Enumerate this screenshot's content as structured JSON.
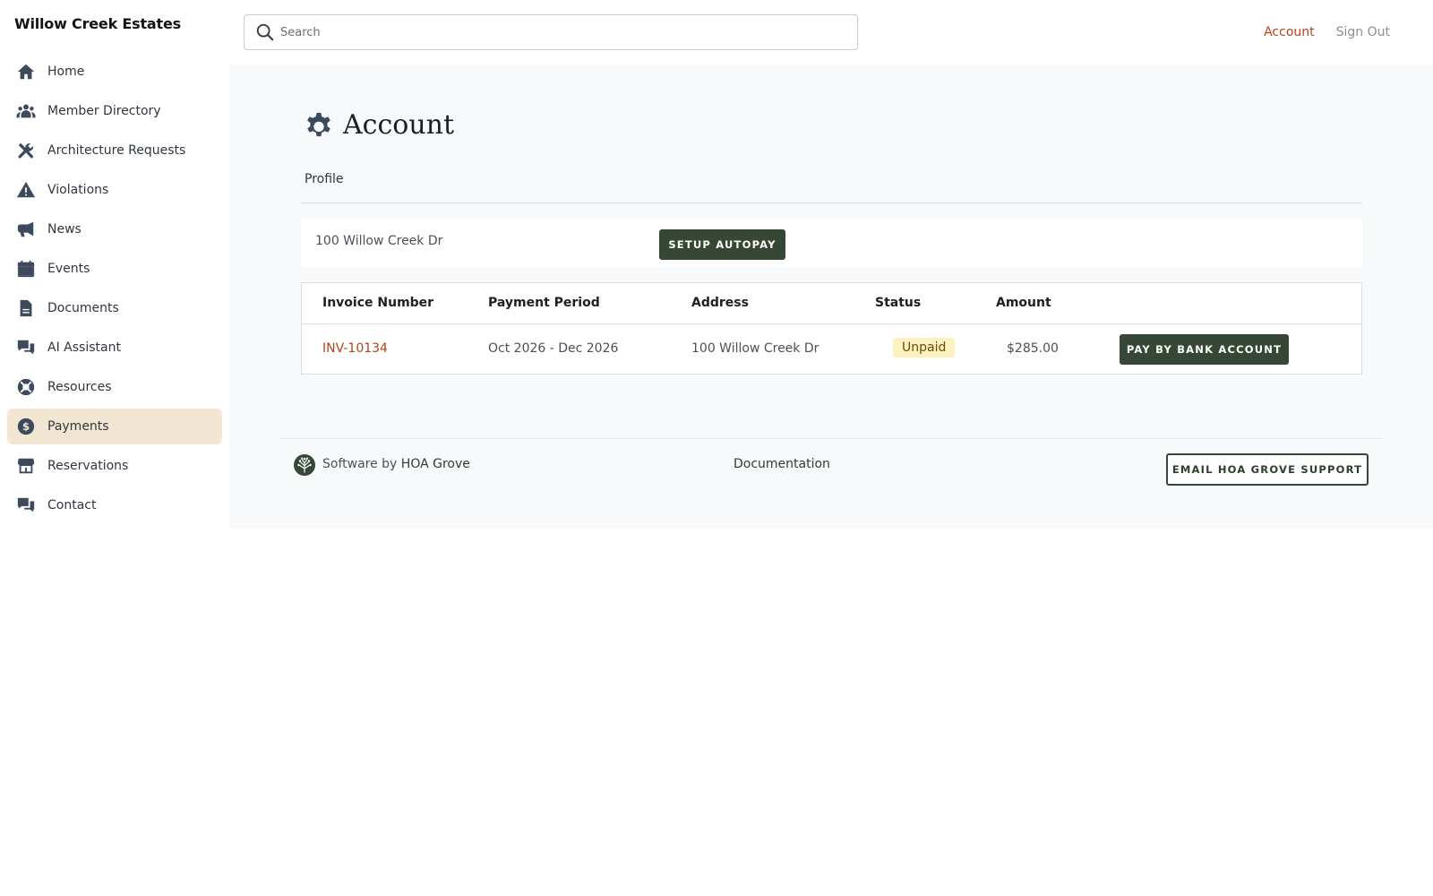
{
  "brand": "Willow Creek Estates",
  "search": {
    "placeholder": "Search"
  },
  "top_links": {
    "account": "Account",
    "sign_out": "Sign Out"
  },
  "sidebar": {
    "items": [
      {
        "label": "Home",
        "icon": "home-icon"
      },
      {
        "label": "Member Directory",
        "icon": "users-icon"
      },
      {
        "label": "Architecture Requests",
        "icon": "tools-icon"
      },
      {
        "label": "Violations",
        "icon": "warning-icon"
      },
      {
        "label": "News",
        "icon": "megaphone-icon"
      },
      {
        "label": "Events",
        "icon": "calendar-icon"
      },
      {
        "label": "Documents",
        "icon": "document-icon"
      },
      {
        "label": "AI Assistant",
        "icon": "chat-icon"
      },
      {
        "label": "Resources",
        "icon": "lifebuoy-icon"
      },
      {
        "label": "Payments",
        "icon": "dollar-icon",
        "active": true
      },
      {
        "label": "Reservations",
        "icon": "building-icon"
      },
      {
        "label": "Contact",
        "icon": "chat-icon"
      }
    ]
  },
  "page": {
    "title": "Account",
    "subtab": "Profile",
    "address": "100 Willow Creek Dr",
    "setup_autopay": "SETUP AUTOPAY"
  },
  "invoices": {
    "headers": [
      "Invoice Number",
      "Payment Period",
      "Address",
      "Status",
      "Amount"
    ],
    "rows": [
      {
        "invoice": "INV-10134",
        "period": "Oct 2026 - Dec 2026",
        "address": "100 Willow Creek Dr",
        "status": "Unpaid",
        "amount": "$285.00",
        "action": "PAY BY BANK ACCOUNT"
      }
    ]
  },
  "footer": {
    "software_by": "Software by",
    "vendor": "HOA Grove",
    "documentation": "Documentation",
    "support_button": "EMAIL HOA GROVE SUPPORT"
  },
  "colors": {
    "accent_dark_green": "#364735",
    "link_orange": "#b5431b",
    "active_nav_bg": "#f1e6d2",
    "badge_bg": "#fdf1c0"
  }
}
